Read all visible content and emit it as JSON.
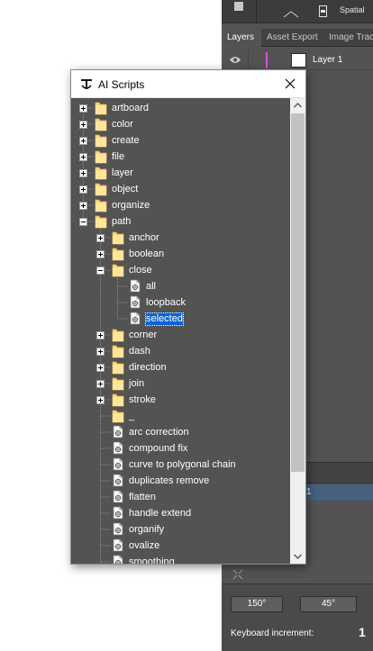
{
  "illustrator": {
    "spatial_label": "Spatial",
    "tabs": [
      {
        "label": "Layers",
        "active": true
      },
      {
        "label": "Asset Export",
        "active": false
      },
      {
        "label": "Image Trace",
        "active": false
      }
    ],
    "layer_name": "Layer 1",
    "layer_color": "#e14ee0",
    "selected_row_text": "1",
    "angle_buttons": [
      "150°",
      "45°"
    ],
    "keyboard_increment_label": "Keyboard increment:",
    "keyboard_increment_value": "1"
  },
  "window": {
    "title": "AI Scripts",
    "close_icon": "close-icon",
    "app_icon": "ai-scripts-logo-icon"
  },
  "colors": {
    "tree_bg": "#535353",
    "selection": "#0a64d7",
    "folder": "#ffd777",
    "ai_panel": "#535353"
  },
  "tree": [
    {
      "label": "artboard",
      "kind": "folder",
      "level": 0,
      "toggle": "plus"
    },
    {
      "label": "color",
      "kind": "folder",
      "level": 0,
      "toggle": "plus"
    },
    {
      "label": "create",
      "kind": "folder",
      "level": 0,
      "toggle": "plus"
    },
    {
      "label": "file",
      "kind": "folder",
      "level": 0,
      "toggle": "plus"
    },
    {
      "label": "layer",
      "kind": "folder",
      "level": 0,
      "toggle": "plus"
    },
    {
      "label": "object",
      "kind": "folder",
      "level": 0,
      "toggle": "plus"
    },
    {
      "label": "organize",
      "kind": "folder",
      "level": 0,
      "toggle": "plus"
    },
    {
      "label": "path",
      "kind": "folder",
      "level": 0,
      "toggle": "minus"
    },
    {
      "label": "anchor",
      "kind": "folder",
      "level": 1,
      "toggle": "plus"
    },
    {
      "label": "boolean",
      "kind": "folder",
      "level": 1,
      "toggle": "plus"
    },
    {
      "label": "close",
      "kind": "folder",
      "level": 1,
      "toggle": "minus"
    },
    {
      "label": "all",
      "kind": "file",
      "level": 2,
      "toggle": null
    },
    {
      "label": "loopback",
      "kind": "file",
      "level": 2,
      "toggle": null
    },
    {
      "label": "selected",
      "kind": "file",
      "level": 2,
      "toggle": null,
      "selected": true
    },
    {
      "label": "corner",
      "kind": "folder",
      "level": 1,
      "toggle": "plus"
    },
    {
      "label": "dash",
      "kind": "folder",
      "level": 1,
      "toggle": "plus"
    },
    {
      "label": "direction",
      "kind": "folder",
      "level": 1,
      "toggle": "plus"
    },
    {
      "label": "join",
      "kind": "folder",
      "level": 1,
      "toggle": "plus"
    },
    {
      "label": "stroke",
      "kind": "folder",
      "level": 1,
      "toggle": "plus"
    },
    {
      "label": "_",
      "kind": "folder",
      "level": 1,
      "toggle": null
    },
    {
      "label": "arc correction",
      "kind": "file",
      "level": 1,
      "toggle": null
    },
    {
      "label": "compound fix",
      "kind": "file",
      "level": 1,
      "toggle": null
    },
    {
      "label": "curve to polygonal chain",
      "kind": "file",
      "level": 1,
      "toggle": null
    },
    {
      "label": "duplicates remove",
      "kind": "file",
      "level": 1,
      "toggle": null
    },
    {
      "label": "flatten",
      "kind": "file",
      "level": 1,
      "toggle": null
    },
    {
      "label": "handle extend",
      "kind": "file",
      "level": 1,
      "toggle": null
    },
    {
      "label": "organify",
      "kind": "file",
      "level": 1,
      "toggle": null
    },
    {
      "label": "ovalize",
      "kind": "file",
      "level": 1,
      "toggle": null
    },
    {
      "label": "smoothing",
      "kind": "file",
      "level": 1,
      "toggle": null
    }
  ]
}
